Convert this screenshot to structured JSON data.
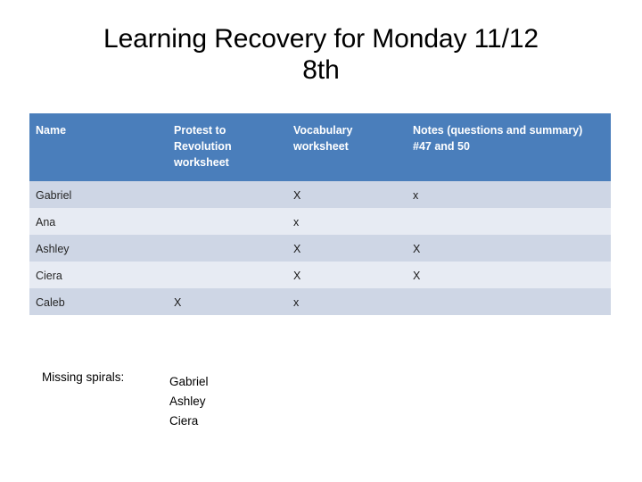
{
  "slide": {
    "title_line1": "Learning Recovery for Monday 11/12",
    "title_line2": "8th",
    "header_fill": "#4a7ebb",
    "row_dark_fill": "#ced6e5",
    "row_light_fill": "#e7ebf3"
  },
  "table": {
    "columns": [
      "Name",
      "Protest to Revolution worksheet",
      "Vocabulary worksheet",
      "Notes (questions and summary) #47 and 50"
    ],
    "column_headers": {
      "name": "Name",
      "protest": "Protest to Revolution worksheet",
      "vocabulary": "Vocabulary worksheet",
      "notes": "Notes (questions and summary) #47 and 50"
    },
    "rows": [
      {
        "name": "Gabriel",
        "protest": "",
        "vocabulary": "X",
        "notes": "x"
      },
      {
        "name": "Ana",
        "protest": "",
        "vocabulary": "x",
        "notes": ""
      },
      {
        "name": "Ashley",
        "protest": "",
        "vocabulary": "X",
        "notes": "X"
      },
      {
        "name": "Ciera",
        "protest": "",
        "vocabulary": "X",
        "notes": "X"
      },
      {
        "name": "Caleb",
        "protest": "X",
        "vocabulary": "x",
        "notes": ""
      }
    ]
  },
  "missing_spirals": {
    "label": "Missing spirals:",
    "names": [
      "Gabriel",
      "Ashley",
      "Ciera"
    ],
    "name1": "Gabriel",
    "name2": "Ashley",
    "name3": "Ciera"
  }
}
